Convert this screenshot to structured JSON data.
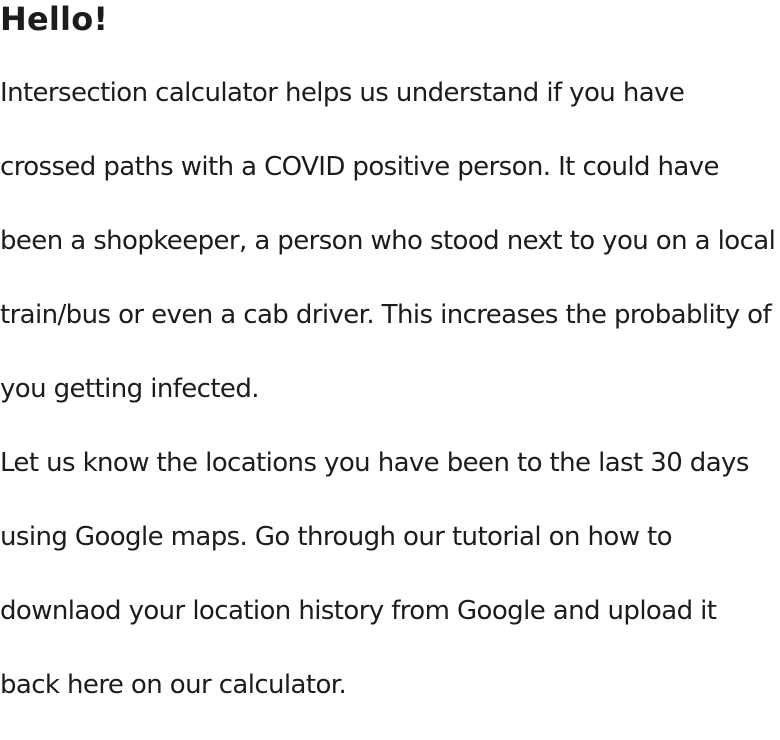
{
  "greeting": "Hello!",
  "paragraphs": [
    "Intersection calculator helps us understand if you have crossed paths with a COVID positive person. It could have been a shopkeeper, a person who stood next to you on a local train/bus or even a cab driver. This increases the probablity of you getting infected.",
    "Let us know the locations you have been to the last 30 days using Google maps. Go through our tutorial on how to downlaod your location history from Google and upload it back here on our calculator."
  ]
}
